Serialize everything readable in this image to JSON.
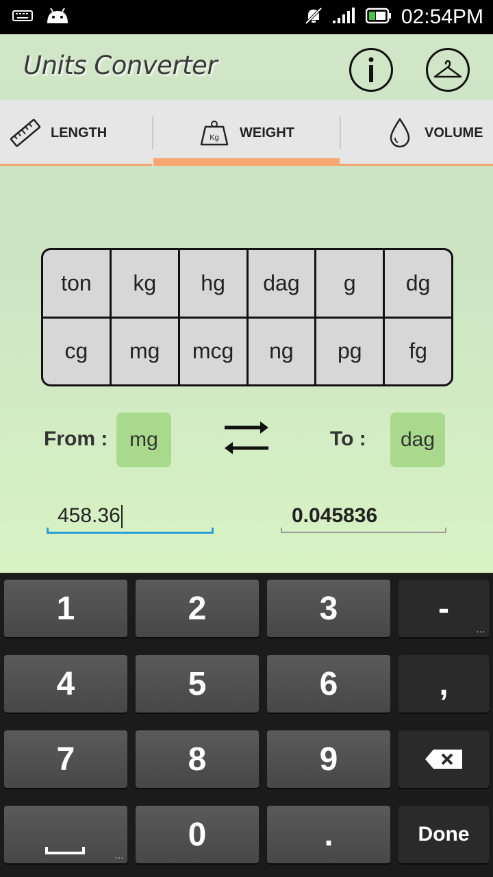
{
  "status_bar": {
    "time": "02:54PM",
    "icons": [
      "keyboard-icon",
      "android-icon",
      "mute-icon",
      "signal-icon",
      "battery-icon"
    ]
  },
  "app": {
    "title": "Units Converter",
    "info_icon": "info-icon",
    "hanger_icon": "hanger-icon"
  },
  "tabs": [
    {
      "label": "LENGTH",
      "icon": "ruler-icon",
      "active": false
    },
    {
      "label": "WEIGHT",
      "icon": "weight-icon",
      "icon_text": "Kg",
      "active": true
    },
    {
      "label": "VOLUME",
      "icon": "drop-icon",
      "active": false
    }
  ],
  "units": {
    "row1": [
      "ton",
      "kg",
      "hg",
      "dag",
      "g",
      "dg"
    ],
    "row2": [
      "cg",
      "mg",
      "mcg",
      "ng",
      "pg",
      "fg"
    ]
  },
  "conversion": {
    "from_label": "From :",
    "from_unit": "mg",
    "to_label": "To :",
    "to_unit": "dag",
    "input_value": "458.36",
    "result_value": "0.045836"
  },
  "keyboard": {
    "row1": [
      "1",
      "2",
      "3",
      "-"
    ],
    "row2": [
      "4",
      "5",
      "6",
      ","
    ],
    "row3": [
      "7",
      "8",
      "9"
    ],
    "row4": [
      "0",
      "."
    ],
    "done": "Done",
    "accent": "#2a9fd6"
  }
}
